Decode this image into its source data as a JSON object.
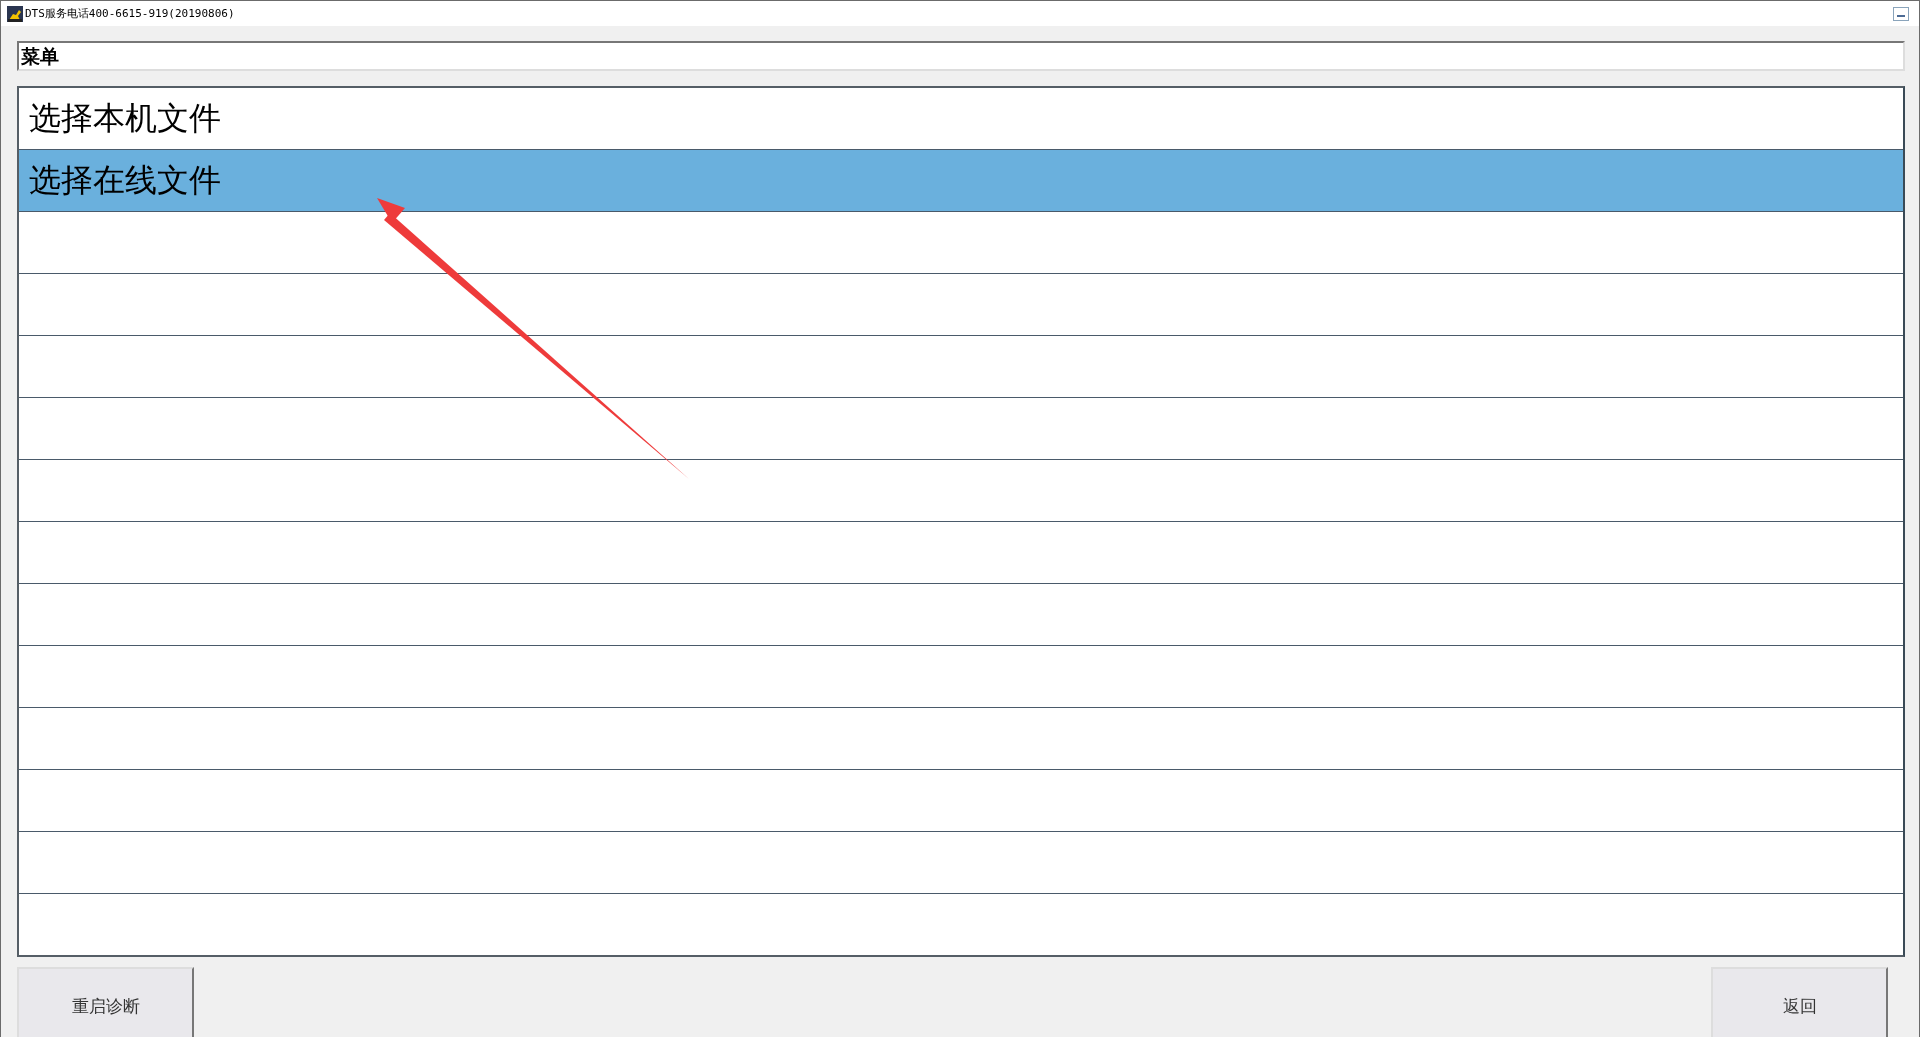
{
  "window": {
    "title": "DTS服务电话400-6615-919(20190806)"
  },
  "header": {
    "value": "菜单"
  },
  "menu": {
    "items": [
      {
        "label": "选择本机文件",
        "selected": false
      },
      {
        "label": "选择在线文件",
        "selected": true
      }
    ]
  },
  "buttons": [
    {
      "label": "重启诊断",
      "kind": "left"
    },
    {
      "label": "返回",
      "kind": "right"
    }
  ]
}
